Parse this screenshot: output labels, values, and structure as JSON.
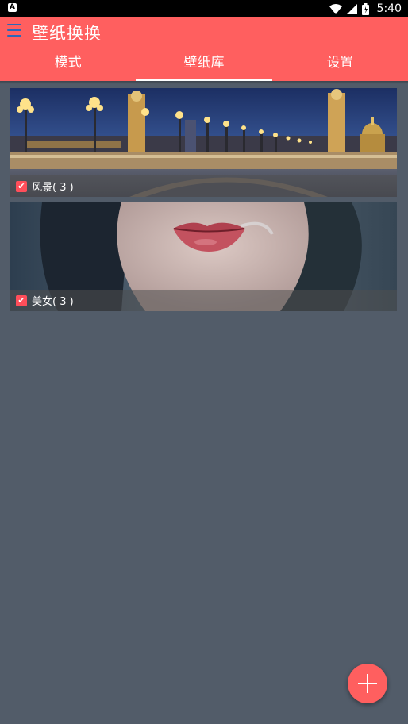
{
  "status_bar": {
    "time": "5:40",
    "left_badge": "A"
  },
  "app": {
    "title": "壁纸换换"
  },
  "tabs": [
    {
      "label": "模式"
    },
    {
      "label": "壁纸库",
      "active": true
    },
    {
      "label": "设置"
    }
  ],
  "library": [
    {
      "label": "风景( 3 )",
      "checked": true,
      "image": "paris-bridge-night"
    },
    {
      "label": "美女( 3 )",
      "checked": true,
      "image": "woman-lips-portrait"
    }
  ],
  "colors": {
    "accent": "#ff5f5f",
    "background": "#525c69",
    "checkbox": "#ff4e5a"
  },
  "icons": {
    "menu": "menu-icon",
    "fab": "plus-icon"
  }
}
